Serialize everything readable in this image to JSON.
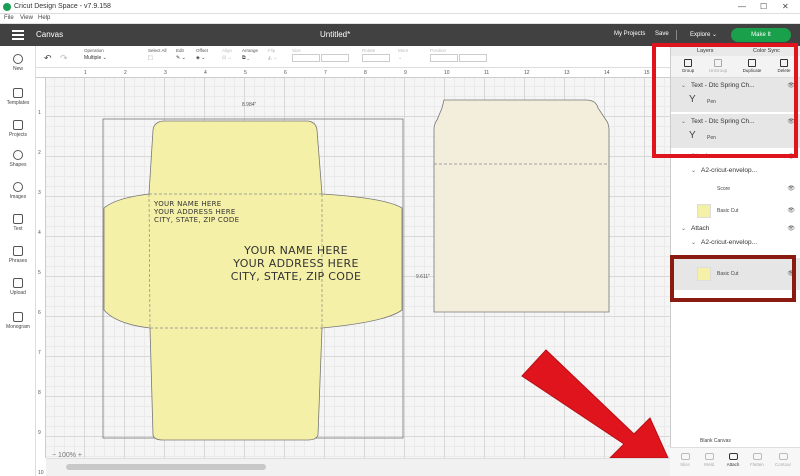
{
  "window": {
    "title": "Cricut Design Space - v7.9.158",
    "min": "—",
    "max": "☐",
    "close": "✕"
  },
  "menu": [
    "File",
    "View",
    "Help"
  ],
  "header": {
    "section": "Canvas",
    "project": "Untitled*",
    "my_projects": "My Projects",
    "save": "Save",
    "machine": "Explore",
    "make_it": "Make It"
  },
  "left_tools": [
    {
      "label": "New",
      "icon": "plus-icon"
    },
    {
      "label": "Templates",
      "icon": "shirt-icon"
    },
    {
      "label": "Projects",
      "icon": "projects-icon"
    },
    {
      "label": "Shapes",
      "icon": "shapes-icon"
    },
    {
      "label": "Images",
      "icon": "lightbulb-icon"
    },
    {
      "label": "Text",
      "icon": "text-icon"
    },
    {
      "label": "Phrases",
      "icon": "phrases-icon"
    },
    {
      "label": "Upload",
      "icon": "upload-icon"
    },
    {
      "label": "Monogram",
      "icon": "monogram-icon"
    }
  ],
  "edit_toolbar": {
    "operation_label": "Operation",
    "operation_value": "Multiple",
    "select_all": "Select All",
    "edit": "Edit",
    "offset": "Offset",
    "align": "Align",
    "arrange": "Arrange",
    "flip": "Flip",
    "size": "Size",
    "rotate": "Rotate",
    "more": "More",
    "position": "Position"
  },
  "ruler_top": [
    "1",
    "2",
    "3",
    "4",
    "5",
    "6",
    "7",
    "8",
    "9",
    "10",
    "11",
    "12",
    "13",
    "14",
    "15"
  ],
  "ruler_left": [
    "1",
    "2",
    "3",
    "4",
    "5",
    "6",
    "7",
    "8",
    "9",
    "10"
  ],
  "canvas": {
    "width_dim": "8.984\"",
    "height_dim": "9.611\"",
    "small_address": [
      "YOUR NAME HERE",
      "YOUR ADDRESS HERE",
      "CITY, STATE, ZIP CODE"
    ],
    "large_address": [
      "YOUR NAME HERE",
      "YOUR ADDRESS HERE",
      "CITY, STATE, ZIP CODE"
    ],
    "zoom": "100%",
    "zoom_minus": "−",
    "zoom_plus": "+"
  },
  "layers": {
    "tab_layers": "Layers",
    "tab_color_sync": "Color Sync",
    "tools": [
      {
        "label": "Group",
        "enabled": true
      },
      {
        "label": "UnGroup",
        "enabled": false
      },
      {
        "label": "Duplicate",
        "enabled": true
      },
      {
        "label": "Delete",
        "enabled": true
      }
    ],
    "text1": "Text - Dtc Spring Ch...",
    "text1_sub": "Pen",
    "text2": "Text - Dtc Spring Ch...",
    "text2_sub": "Pen",
    "attach1": "Attach",
    "env1": "A2-cricut-envelop...",
    "score": "Score",
    "basic_cut1": "Basic Cut",
    "attach2": "Attach",
    "env2": "A2-cricut-envelop...",
    "basic_cut2": "Basic Cut",
    "blank_canvas": "Blank Canvas"
  },
  "bottom_tools": [
    {
      "label": "Slice",
      "enabled": false
    },
    {
      "label": "Weld",
      "enabled": false
    },
    {
      "label": "Attach",
      "enabled": true
    },
    {
      "label": "Flatten",
      "enabled": false
    },
    {
      "label": "Contour",
      "enabled": false
    }
  ],
  "colors": {
    "header_bg": "#414141",
    "make_it": "#1aa04a",
    "envelope_yellow": "#f5f0a8",
    "envelope_cream": "#f2eedb",
    "highlight_red": "#e0141c",
    "highlight_dark_red": "#8b1a10"
  }
}
